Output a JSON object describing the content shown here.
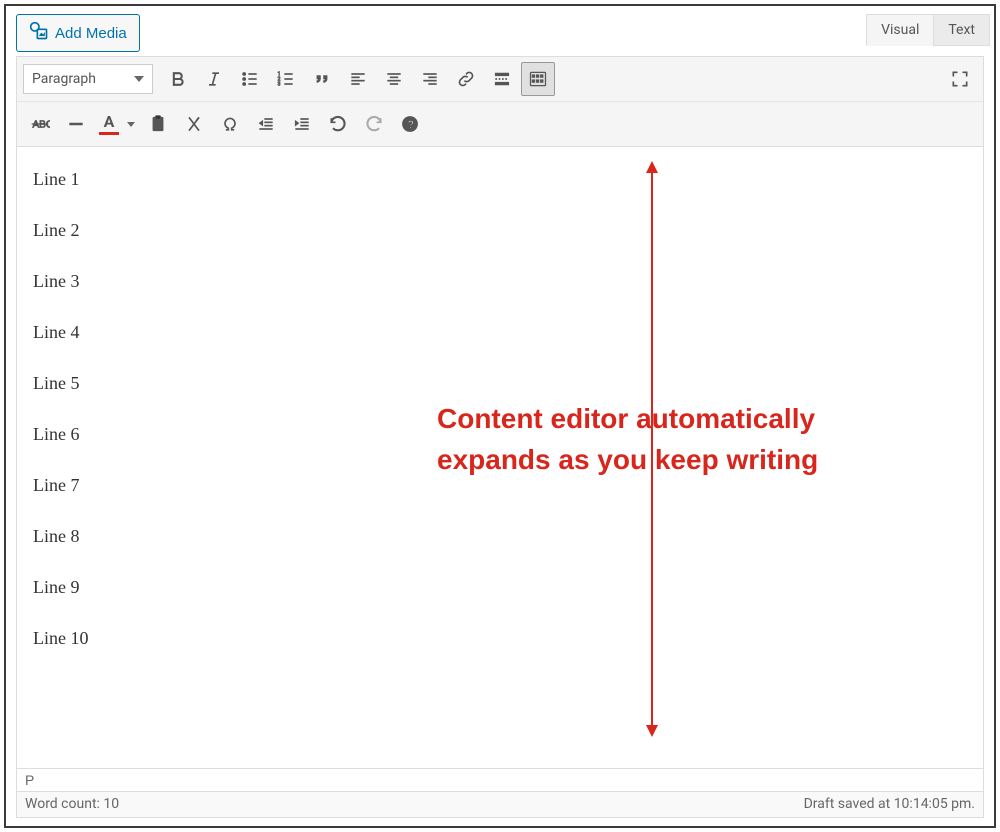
{
  "buttons": {
    "add_media": "Add Media"
  },
  "tabs": {
    "visual": "Visual",
    "text": "Text"
  },
  "format_select": "Paragraph",
  "textcolor_letter": "A",
  "content_lines": [
    "Line 1",
    "Line 2",
    "Line 3",
    "Line 4",
    "Line 5",
    "Line 6",
    "Line 7",
    "Line 8",
    "Line 9",
    "Line 10"
  ],
  "annotation": {
    "line1": "Content editor automatically",
    "line2": "expands as you keep writing"
  },
  "path": "P",
  "status": {
    "word_count": "Word count: 10",
    "draft_saved": "Draft saved at 10:14:05 pm."
  }
}
